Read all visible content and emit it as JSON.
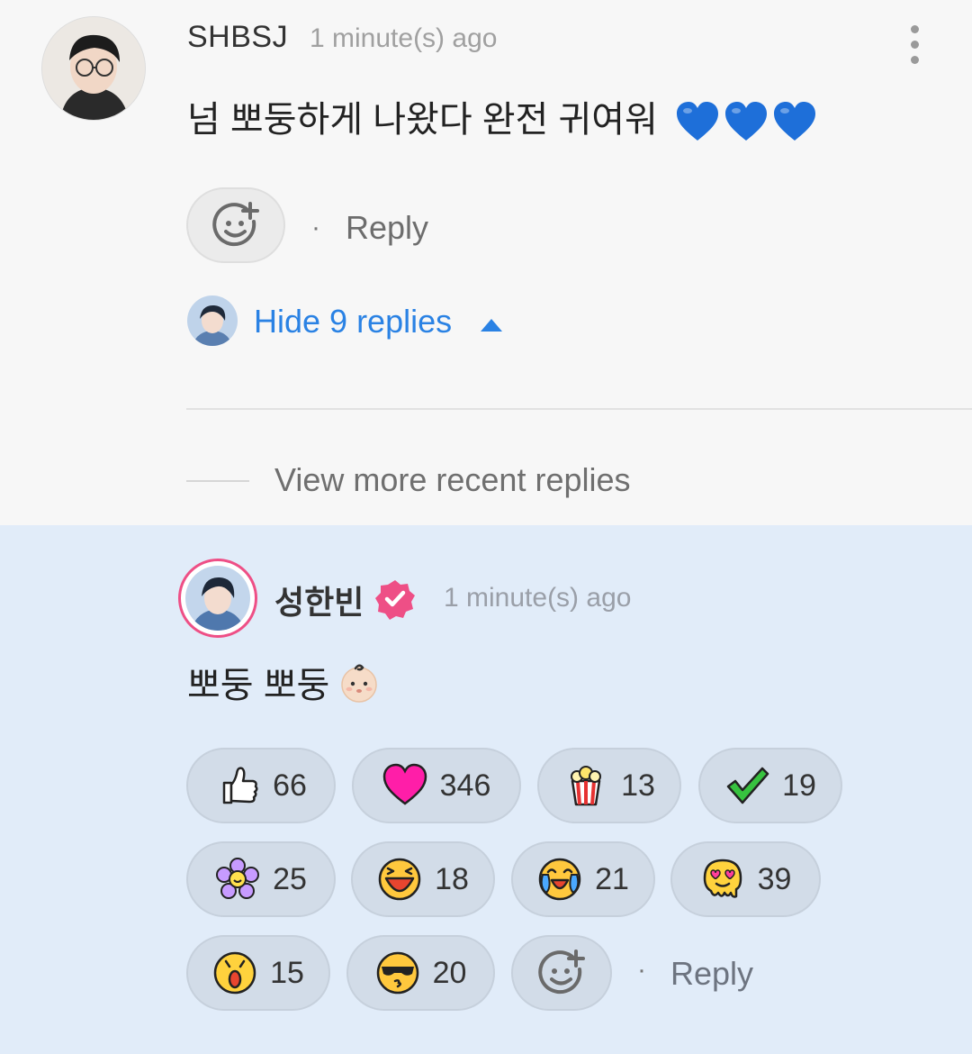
{
  "comment": {
    "username": "SHBSJ",
    "time": "1 minute(s) ago",
    "text": "넘 뽀둥하게 나왔다 완전 귀여워",
    "heart_colors": [
      "#1e6fd9",
      "#1e6fd9",
      "#1e6fd9"
    ],
    "reply_label": "Reply",
    "separator": "·",
    "hide_replies_label": "Hide 9 replies",
    "view_more_label": "View more recent replies"
  },
  "reply": {
    "username": "성한빈",
    "time": "1 minute(s) ago",
    "text": "뽀둥 뽀둥",
    "emoji": "baby-face",
    "reply_label": "Reply",
    "separator": "·",
    "reactions": [
      {
        "icon": "thumbs-up-icon",
        "count": "66"
      },
      {
        "icon": "heart-icon",
        "count": "346"
      },
      {
        "icon": "popcorn-icon",
        "count": "13"
      },
      {
        "icon": "check-icon",
        "count": "19"
      },
      {
        "icon": "flower-icon",
        "count": "25"
      },
      {
        "icon": "laughing-face-icon",
        "count": "18"
      },
      {
        "icon": "crying-laugh-icon",
        "count": "21"
      },
      {
        "icon": "melting-love-icon",
        "count": "39"
      },
      {
        "icon": "surprised-face-icon",
        "count": "15"
      },
      {
        "icon": "sunglasses-kiss-icon",
        "count": "20"
      }
    ]
  },
  "colors": {
    "accent_blue": "#2a82e4",
    "verified_pink": "#ee4f86",
    "highlight_bg": "#e1ecf9"
  }
}
